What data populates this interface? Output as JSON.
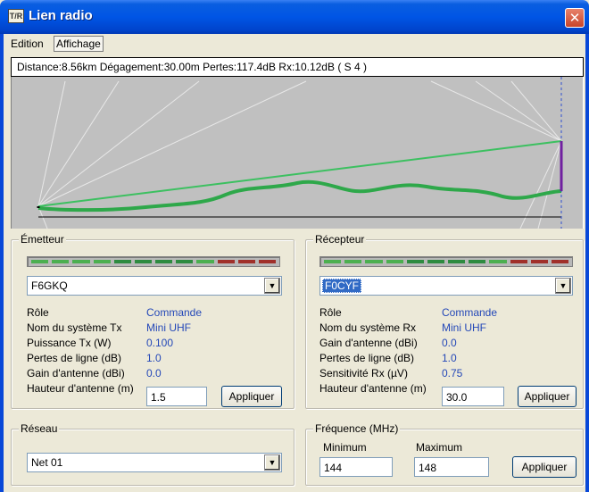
{
  "window": {
    "title": "Lien radio",
    "icon": "T/R",
    "close": "✕"
  },
  "menu": [
    "Edition",
    "Affichage"
  ],
  "status": "Distance:8.56km  Dégagement:30.00m  Pertes:117.4dB  Rx:10.12dB  ( S 4 )",
  "colors": {
    "meter_green": "#4caf50",
    "meter_green_dark": "#2e8b40",
    "meter_red": "#a0302a",
    "profile_line": "#3cc060",
    "terrain": "#2ea84a"
  },
  "emetteur": {
    "title": "Émetteur",
    "selected": "F6GKQ",
    "meter": [
      "g",
      "g",
      "g",
      "g",
      "d",
      "d",
      "d",
      "d",
      "g",
      "r",
      "r",
      "r"
    ],
    "rows": [
      {
        "label": "Rôle",
        "value": "Commande"
      },
      {
        "label": "Nom du système Tx",
        "value": "Mini UHF"
      },
      {
        "label": "Puissance Tx (W)",
        "value": "0.100"
      },
      {
        "label": "Pertes de ligne (dB)",
        "value": "1.0"
      },
      {
        "label": "Gain d'antenne (dBi)",
        "value": "0.0"
      }
    ],
    "height_label": "Hauteur d'antenne (m)",
    "height_value": "1.5",
    "apply": "Appliquer"
  },
  "recepteur": {
    "title": "Récepteur",
    "selected": "F0CYF",
    "meter": [
      "g",
      "g",
      "g",
      "g",
      "d",
      "d",
      "d",
      "d",
      "g",
      "r",
      "r",
      "r"
    ],
    "rows": [
      {
        "label": "Rôle",
        "value": "Commande"
      },
      {
        "label": "Nom du système Rx",
        "value": "Mini UHF"
      },
      {
        "label": "Gain d'antenne (dBi)",
        "value": "0.0"
      },
      {
        "label": "Pertes de ligne (dB)",
        "value": "1.0"
      },
      {
        "label": "Sensitivité Rx (µV)",
        "value": "0.75"
      }
    ],
    "height_label": "Hauteur d'antenne (m)",
    "height_value": "30.0",
    "apply": "Appliquer"
  },
  "reseau": {
    "title": "Réseau",
    "selected": "Net 01"
  },
  "frequence": {
    "title": "Fréquence (MHz)",
    "min_label": "Minimum",
    "min_value": "144",
    "max_label": "Maximum",
    "max_value": "148",
    "apply": "Appliquer"
  }
}
